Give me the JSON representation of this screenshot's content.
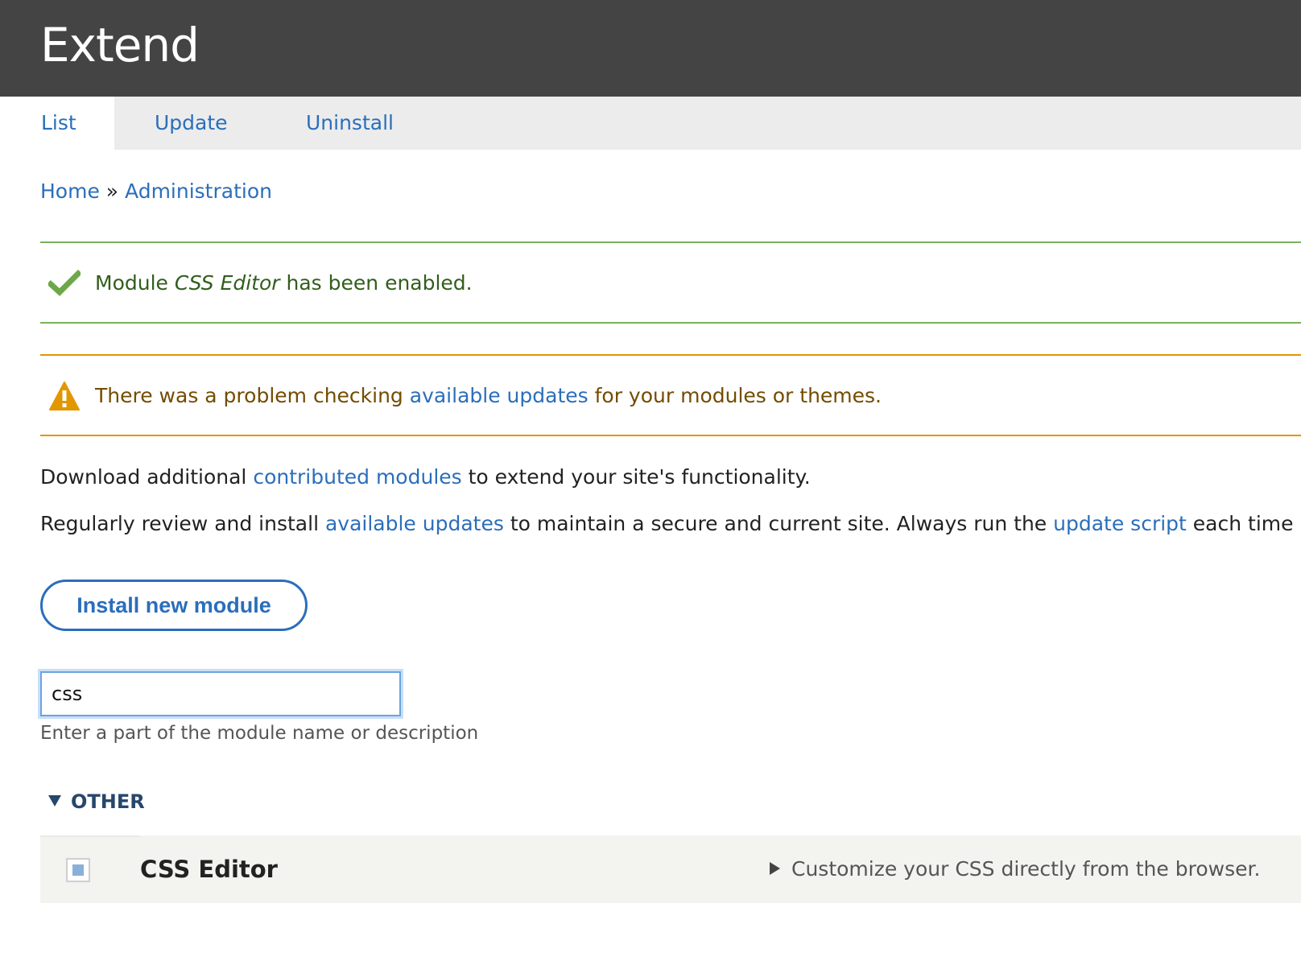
{
  "header": {
    "title": "Extend"
  },
  "tabs": [
    {
      "label": "List",
      "active": true
    },
    {
      "label": "Update",
      "active": false
    },
    {
      "label": "Uninstall",
      "active": false
    }
  ],
  "breadcrumb": {
    "home": "Home",
    "separator": "»",
    "admin": "Administration"
  },
  "messages": {
    "status": {
      "icon": "check-icon",
      "prefix": "Module ",
      "module": "CSS Editor",
      "suffix": " has been enabled."
    },
    "warning": {
      "icon": "warning-icon",
      "prefix": "There was a problem checking ",
      "link": "available updates",
      "suffix": " for your modules or themes."
    }
  },
  "description": {
    "line1": {
      "prefix": "Download additional ",
      "link": "contributed modules",
      "suffix": " to extend your site's functionality."
    },
    "line2": {
      "prefix": "Regularly review and install ",
      "link1": "available updates",
      "middle": " to maintain a secure and current site. Always run the ",
      "link2": "update script",
      "suffix": " each time a moc"
    }
  },
  "install_button": {
    "label": "Install new module"
  },
  "filter": {
    "value": "css",
    "help": "Enter a part of the module name or description"
  },
  "group": {
    "label": "OTHER",
    "modules": [
      {
        "name": "CSS Editor",
        "description": "Customize your CSS directly from the browser.",
        "checked": true
      }
    ]
  },
  "colors": {
    "header_bg": "#444444",
    "link": "#2a6ebb",
    "status_border": "#77b259",
    "warning_border": "#e09600"
  }
}
